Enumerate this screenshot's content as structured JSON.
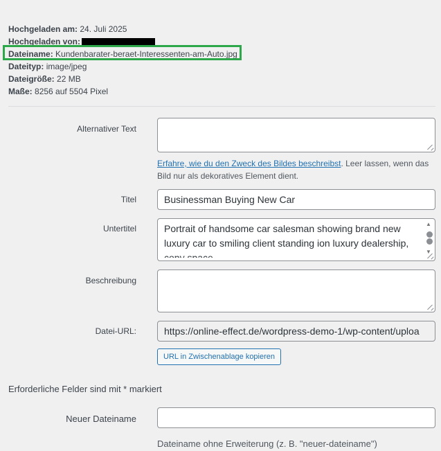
{
  "meta": {
    "uploaded_on_label": "Hochgeladen am:",
    "uploaded_on_value": "24. Juli 2025",
    "uploaded_by_label": "Hochgeladen von:",
    "filename_label": "Dateiname:",
    "filename_value": "Kundenbarater-beraet-Interessenten-am-Auto.jpg",
    "filetype_label": "Dateityp:",
    "filetype_value": "image/jpeg",
    "filesize_label": "Dateigröße:",
    "filesize_value": "22 MB",
    "dimensions_label": "Maße:",
    "dimensions_value": "8256 auf 5504 Pixel"
  },
  "form": {
    "alt_label": "Alternativer Text",
    "alt_value": "",
    "alt_help_link": "Erfahre, wie du den Zweck des Bildes beschreibst",
    "alt_help_text": ". Leer lassen, wenn das Bild nur als dekoratives Element dient.",
    "title_label": "Titel",
    "title_value": "Businessman Buying New Car",
    "caption_label": "Untertitel",
    "caption_value": "Portrait of handsome car salesman showing brand new luxury car to smiling client standing ion luxury dealership, copy space",
    "description_label": "Beschreibung",
    "description_value": "",
    "url_label": "Datei-URL:",
    "url_value": "https://online-effect.de/wordpress-demo-1/wp-content/uploa",
    "copy_button": "URL in Zwischenablage kopieren",
    "required_note": "Erforderliche Felder sind mit * markiert",
    "new_filename_label": "Neuer Dateiname",
    "new_filename_value": "",
    "new_filename_help": "Dateiname ohne Erweiterung (z. B. \"neuer-dateiname\")"
  },
  "colors": {
    "highlight": "#2ca74a",
    "link": "#2271b1"
  }
}
